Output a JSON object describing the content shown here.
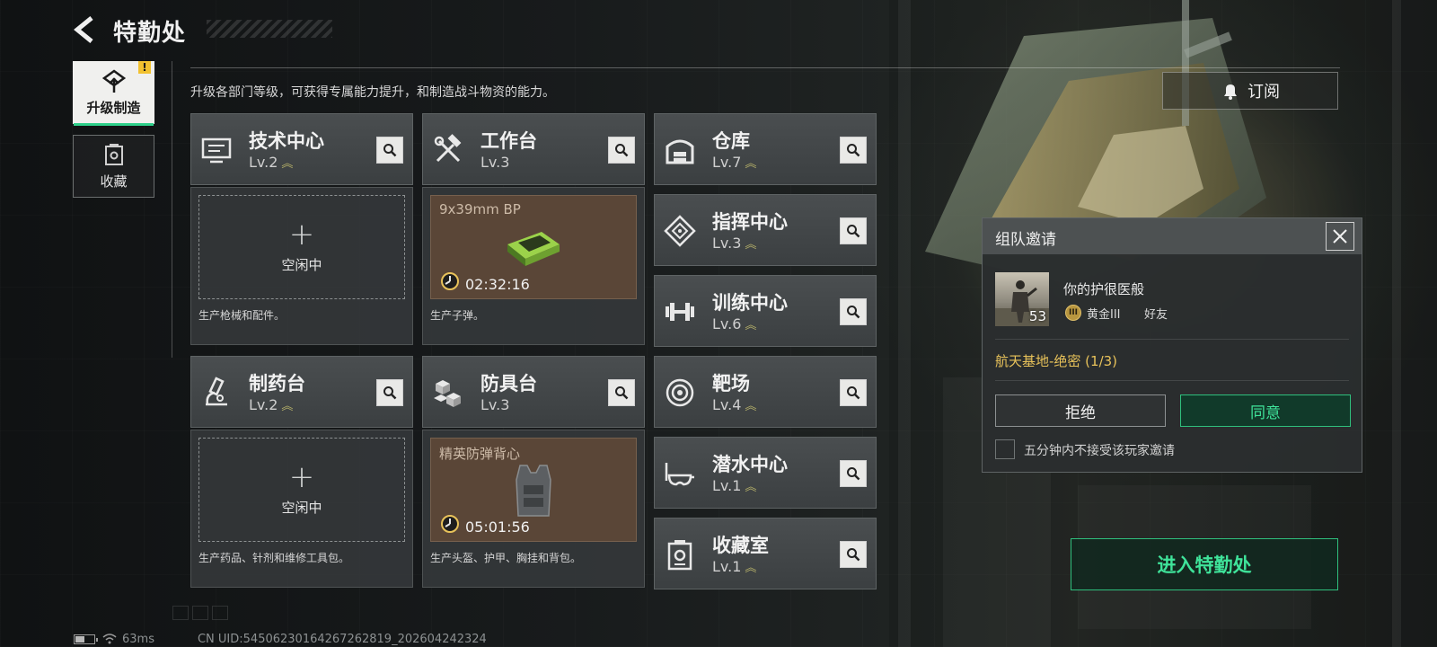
{
  "header": {
    "title": "特勤处"
  },
  "sidebar": {
    "tabs": [
      {
        "label": "升级制造",
        "active": true,
        "alert": "!"
      },
      {
        "label": "收藏",
        "active": false
      }
    ]
  },
  "subtitle": "升级各部门等级，可获得专属能力提升，和制造战斗物资的能力。",
  "departments": [
    {
      "name": "技术中心",
      "level": "Lv.2",
      "icon": "monitor-icon"
    },
    {
      "name": "工作台",
      "level": "Lv.3",
      "icon": "tools-icon"
    },
    {
      "name": "仓库",
      "level": "Lv.7",
      "icon": "warehouse-icon"
    },
    {
      "name": "指挥中心",
      "level": "Lv.3",
      "icon": "command-icon"
    },
    {
      "name": "训练中心",
      "level": "Lv.6",
      "icon": "dumbbell-icon"
    },
    {
      "name": "制药台",
      "level": "Lv.2",
      "icon": "microscope-icon"
    },
    {
      "name": "防具台",
      "level": "Lv.3",
      "icon": "armor-blocks-icon"
    },
    {
      "name": "靶场",
      "level": "Lv.4",
      "icon": "target-icon"
    },
    {
      "name": "潜水中心",
      "level": "Lv.1",
      "icon": "diving-goggles-icon"
    },
    {
      "name": "收藏室",
      "level": "Lv.1",
      "icon": "collection-icon"
    }
  ],
  "production": {
    "tech_center": {
      "status": "空闲中",
      "desc": "生产枪械和配件。"
    },
    "workbench": {
      "item": "9x39mm BP",
      "timer": "02:32:16",
      "desc": "生产子弹。"
    },
    "pharmacy": {
      "status": "空闲中",
      "desc": "生产药品、针剂和维修工具包。"
    },
    "armor_bench": {
      "item": "精英防弹背心",
      "timer": "05:01:56",
      "desc": "生产头盔、护甲、胸挂和背包。"
    }
  },
  "subscribe": {
    "label": "订阅"
  },
  "invite": {
    "title": "组队邀请",
    "player_name": "你的护很医般",
    "player_level": "53",
    "rank": "黄金III",
    "rank_badge": "III",
    "relation": "好友",
    "mission": "航天基地-绝密 (1/3)",
    "reject": "拒绝",
    "accept": "同意",
    "mute_label": "五分钟内不接受该玩家邀请",
    "mute_checked": false
  },
  "enter_button": {
    "label": "进入特勤处"
  },
  "status_bar": {
    "ping": "63ms",
    "uid": "CN UID:54506230164267262819_202604242324"
  },
  "colors": {
    "accent_green": "#3fe39a",
    "level_chevron": "#b8b36a",
    "mission_gold": "#e8c25a",
    "alert_yellow": "#f2c230"
  }
}
